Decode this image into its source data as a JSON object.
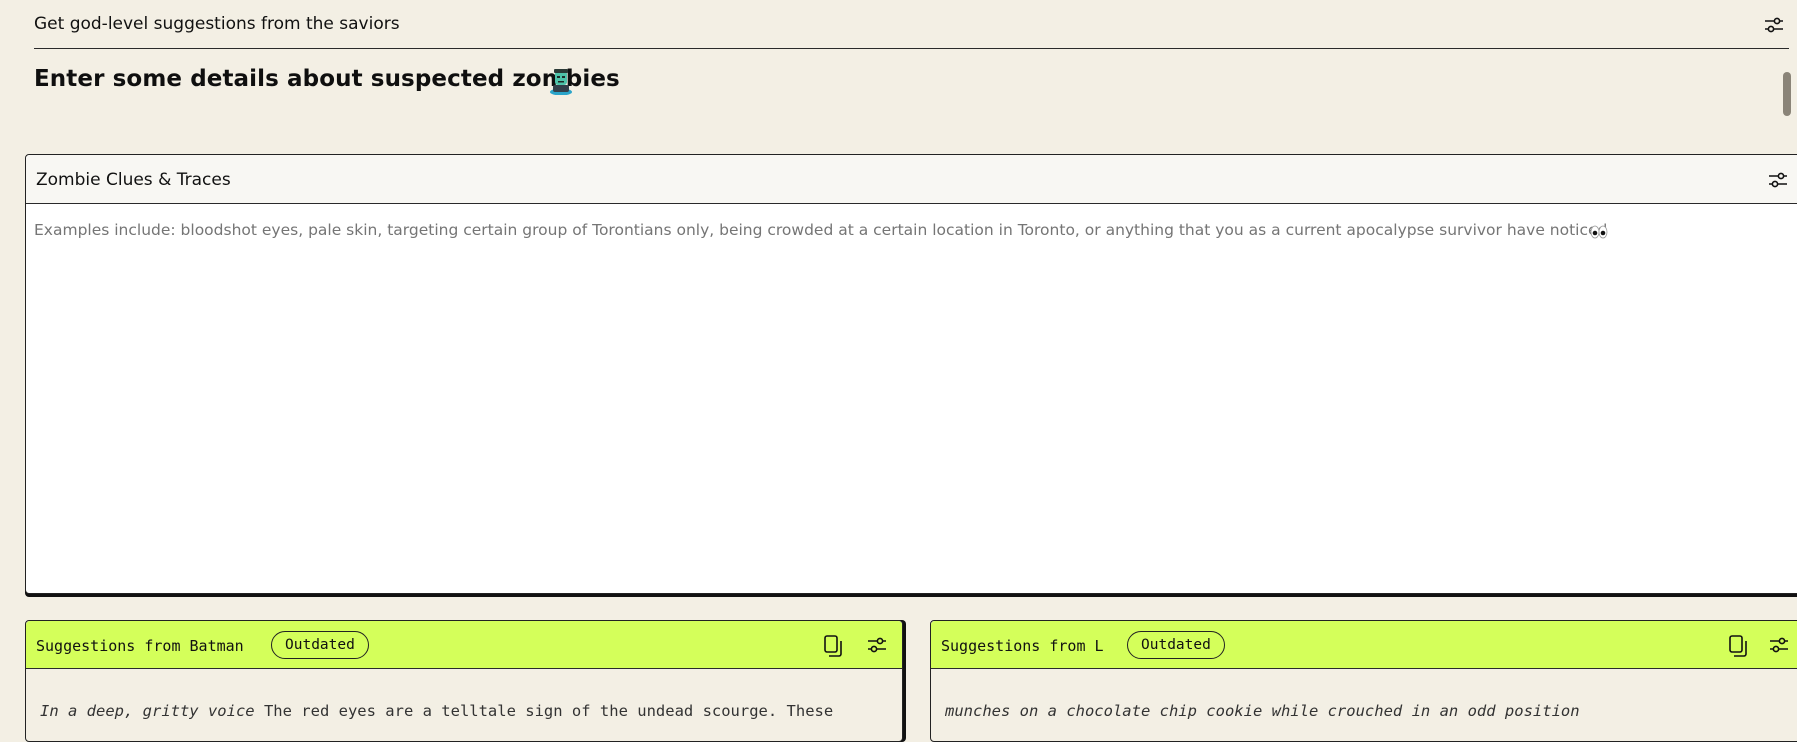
{
  "top_bar": {
    "title": "Get god-level suggestions from the saviors"
  },
  "section": {
    "heading": "Enter some details about suspected zombies"
  },
  "clues_panel": {
    "title": "Zombie Clues & Traces",
    "placeholder": "Examples include: bloodshot eyes, pale skin, targeting certain group of Torontians only, being crowded at a certain location in Toronto, or anything that you as a current apocalypse survivor have noticed"
  },
  "suggestions": [
    {
      "title": "Suggestions from Batman",
      "badge": "Outdated",
      "body_italic": "In a deep, gritty voice",
      "body_rest": " The red eyes are a telltale sign of the undead scourge. These"
    },
    {
      "title": "Suggestions from L",
      "badge": "Outdated",
      "body_italic": "munches on a chocolate chip cookie while crouched in an odd position",
      "body_rest": ""
    }
  ],
  "icons": [
    "sliders-icon",
    "copy-icon",
    "zombie-emoji-icon",
    "eyes-emoji-icon"
  ],
  "colors": {
    "background": "#f3efe4",
    "accent": "#d4ff5a",
    "text": "#111111"
  }
}
